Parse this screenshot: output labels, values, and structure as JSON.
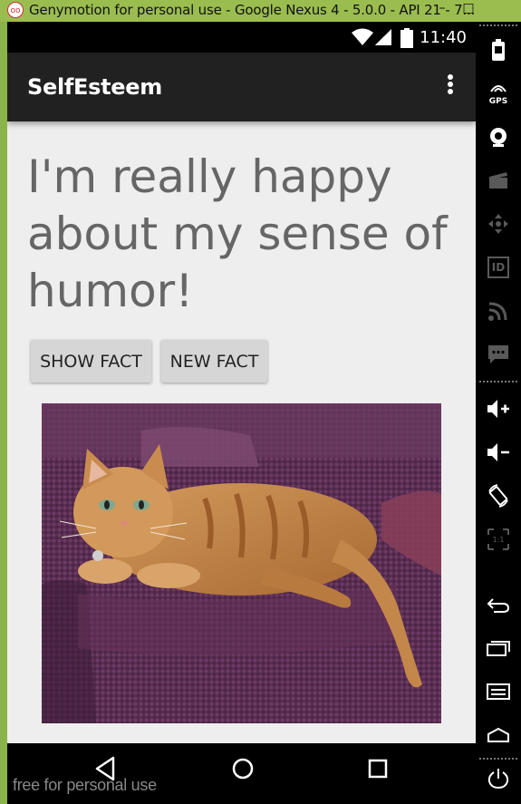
{
  "window": {
    "title": "Genymotion for personal use - Google Nexus 4 - 5.0.0 - API 21 - 7...",
    "app_icon_text": "oo",
    "minimize_glyph": "–",
    "maximize_glyph": "□"
  },
  "status_bar": {
    "time": "11:40",
    "icons": [
      "wifi-icon",
      "signal-icon",
      "battery-icon"
    ]
  },
  "action_bar": {
    "title": "SelfEsteem",
    "menu_icon": "overflow-menu-icon"
  },
  "content": {
    "fact_text": "I'm really happy about my sense of humor!",
    "buttons": {
      "show_fact": "SHOW FACT",
      "new_fact": "NEW FACT"
    },
    "image": "orange-tabby-cat-on-purple-couch"
  },
  "nav_bar": {
    "icons": [
      "back-icon",
      "home-icon",
      "recents-icon"
    ]
  },
  "watermark": "free for personal use",
  "toolbar": {
    "gps_label": "GPS",
    "id_label": "ID",
    "tools": [
      "battery-tool-icon",
      "gps-tool-icon",
      "camera-tool-icon",
      "clapper-tool-icon",
      "move-tool-icon",
      "id-tool-icon",
      "rss-tool-icon",
      "sms-tool-icon",
      "volume-up-icon",
      "volume-down-icon",
      "rotate-icon",
      "scale-icon",
      "back-tool-icon",
      "recent-apps-tool-icon",
      "menu-tool-icon",
      "home-tool-icon",
      "power-icon"
    ]
  },
  "colors": {
    "window_frame": "#9bbd50",
    "action_bar": "#212121",
    "screen_background": "#eeeeee",
    "fact_text": "#666666",
    "button": "#d6d6d6"
  }
}
